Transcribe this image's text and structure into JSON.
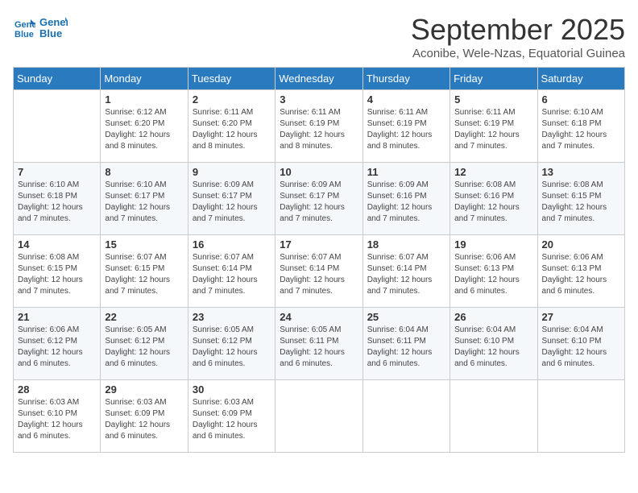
{
  "logo": {
    "line1": "General",
    "line2": "Blue"
  },
  "title": "September 2025",
  "subtitle": "Aconibe, Wele-Nzas, Equatorial Guinea",
  "days_of_week": [
    "Sunday",
    "Monday",
    "Tuesday",
    "Wednesday",
    "Thursday",
    "Friday",
    "Saturday"
  ],
  "weeks": [
    [
      {
        "day": "",
        "sunrise": "",
        "sunset": "",
        "daylight": ""
      },
      {
        "day": "1",
        "sunrise": "Sunrise: 6:12 AM",
        "sunset": "Sunset: 6:20 PM",
        "daylight": "Daylight: 12 hours and 8 minutes."
      },
      {
        "day": "2",
        "sunrise": "Sunrise: 6:11 AM",
        "sunset": "Sunset: 6:20 PM",
        "daylight": "Daylight: 12 hours and 8 minutes."
      },
      {
        "day": "3",
        "sunrise": "Sunrise: 6:11 AM",
        "sunset": "Sunset: 6:19 PM",
        "daylight": "Daylight: 12 hours and 8 minutes."
      },
      {
        "day": "4",
        "sunrise": "Sunrise: 6:11 AM",
        "sunset": "Sunset: 6:19 PM",
        "daylight": "Daylight: 12 hours and 8 minutes."
      },
      {
        "day": "5",
        "sunrise": "Sunrise: 6:11 AM",
        "sunset": "Sunset: 6:19 PM",
        "daylight": "Daylight: 12 hours and 7 minutes."
      },
      {
        "day": "6",
        "sunrise": "Sunrise: 6:10 AM",
        "sunset": "Sunset: 6:18 PM",
        "daylight": "Daylight: 12 hours and 7 minutes."
      }
    ],
    [
      {
        "day": "7",
        "sunrise": "Sunrise: 6:10 AM",
        "sunset": "Sunset: 6:18 PM",
        "daylight": "Daylight: 12 hours and 7 minutes."
      },
      {
        "day": "8",
        "sunrise": "Sunrise: 6:10 AM",
        "sunset": "Sunset: 6:17 PM",
        "daylight": "Daylight: 12 hours and 7 minutes."
      },
      {
        "day": "9",
        "sunrise": "Sunrise: 6:09 AM",
        "sunset": "Sunset: 6:17 PM",
        "daylight": "Daylight: 12 hours and 7 minutes."
      },
      {
        "day": "10",
        "sunrise": "Sunrise: 6:09 AM",
        "sunset": "Sunset: 6:17 PM",
        "daylight": "Daylight: 12 hours and 7 minutes."
      },
      {
        "day": "11",
        "sunrise": "Sunrise: 6:09 AM",
        "sunset": "Sunset: 6:16 PM",
        "daylight": "Daylight: 12 hours and 7 minutes."
      },
      {
        "day": "12",
        "sunrise": "Sunrise: 6:08 AM",
        "sunset": "Sunset: 6:16 PM",
        "daylight": "Daylight: 12 hours and 7 minutes."
      },
      {
        "day": "13",
        "sunrise": "Sunrise: 6:08 AM",
        "sunset": "Sunset: 6:15 PM",
        "daylight": "Daylight: 12 hours and 7 minutes."
      }
    ],
    [
      {
        "day": "14",
        "sunrise": "Sunrise: 6:08 AM",
        "sunset": "Sunset: 6:15 PM",
        "daylight": "Daylight: 12 hours and 7 minutes."
      },
      {
        "day": "15",
        "sunrise": "Sunrise: 6:07 AM",
        "sunset": "Sunset: 6:15 PM",
        "daylight": "Daylight: 12 hours and 7 minutes."
      },
      {
        "day": "16",
        "sunrise": "Sunrise: 6:07 AM",
        "sunset": "Sunset: 6:14 PM",
        "daylight": "Daylight: 12 hours and 7 minutes."
      },
      {
        "day": "17",
        "sunrise": "Sunrise: 6:07 AM",
        "sunset": "Sunset: 6:14 PM",
        "daylight": "Daylight: 12 hours and 7 minutes."
      },
      {
        "day": "18",
        "sunrise": "Sunrise: 6:07 AM",
        "sunset": "Sunset: 6:14 PM",
        "daylight": "Daylight: 12 hours and 7 minutes."
      },
      {
        "day": "19",
        "sunrise": "Sunrise: 6:06 AM",
        "sunset": "Sunset: 6:13 PM",
        "daylight": "Daylight: 12 hours and 6 minutes."
      },
      {
        "day": "20",
        "sunrise": "Sunrise: 6:06 AM",
        "sunset": "Sunset: 6:13 PM",
        "daylight": "Daylight: 12 hours and 6 minutes."
      }
    ],
    [
      {
        "day": "21",
        "sunrise": "Sunrise: 6:06 AM",
        "sunset": "Sunset: 6:12 PM",
        "daylight": "Daylight: 12 hours and 6 minutes."
      },
      {
        "day": "22",
        "sunrise": "Sunrise: 6:05 AM",
        "sunset": "Sunset: 6:12 PM",
        "daylight": "Daylight: 12 hours and 6 minutes."
      },
      {
        "day": "23",
        "sunrise": "Sunrise: 6:05 AM",
        "sunset": "Sunset: 6:12 PM",
        "daylight": "Daylight: 12 hours and 6 minutes."
      },
      {
        "day": "24",
        "sunrise": "Sunrise: 6:05 AM",
        "sunset": "Sunset: 6:11 PM",
        "daylight": "Daylight: 12 hours and 6 minutes."
      },
      {
        "day": "25",
        "sunrise": "Sunrise: 6:04 AM",
        "sunset": "Sunset: 6:11 PM",
        "daylight": "Daylight: 12 hours and 6 minutes."
      },
      {
        "day": "26",
        "sunrise": "Sunrise: 6:04 AM",
        "sunset": "Sunset: 6:10 PM",
        "daylight": "Daylight: 12 hours and 6 minutes."
      },
      {
        "day": "27",
        "sunrise": "Sunrise: 6:04 AM",
        "sunset": "Sunset: 6:10 PM",
        "daylight": "Daylight: 12 hours and 6 minutes."
      }
    ],
    [
      {
        "day": "28",
        "sunrise": "Sunrise: 6:03 AM",
        "sunset": "Sunset: 6:10 PM",
        "daylight": "Daylight: 12 hours and 6 minutes."
      },
      {
        "day": "29",
        "sunrise": "Sunrise: 6:03 AM",
        "sunset": "Sunset: 6:09 PM",
        "daylight": "Daylight: 12 hours and 6 minutes."
      },
      {
        "day": "30",
        "sunrise": "Sunrise: 6:03 AM",
        "sunset": "Sunset: 6:09 PM",
        "daylight": "Daylight: 12 hours and 6 minutes."
      },
      {
        "day": "",
        "sunrise": "",
        "sunset": "",
        "daylight": ""
      },
      {
        "day": "",
        "sunrise": "",
        "sunset": "",
        "daylight": ""
      },
      {
        "day": "",
        "sunrise": "",
        "sunset": "",
        "daylight": ""
      },
      {
        "day": "",
        "sunrise": "",
        "sunset": "",
        "daylight": ""
      }
    ]
  ]
}
